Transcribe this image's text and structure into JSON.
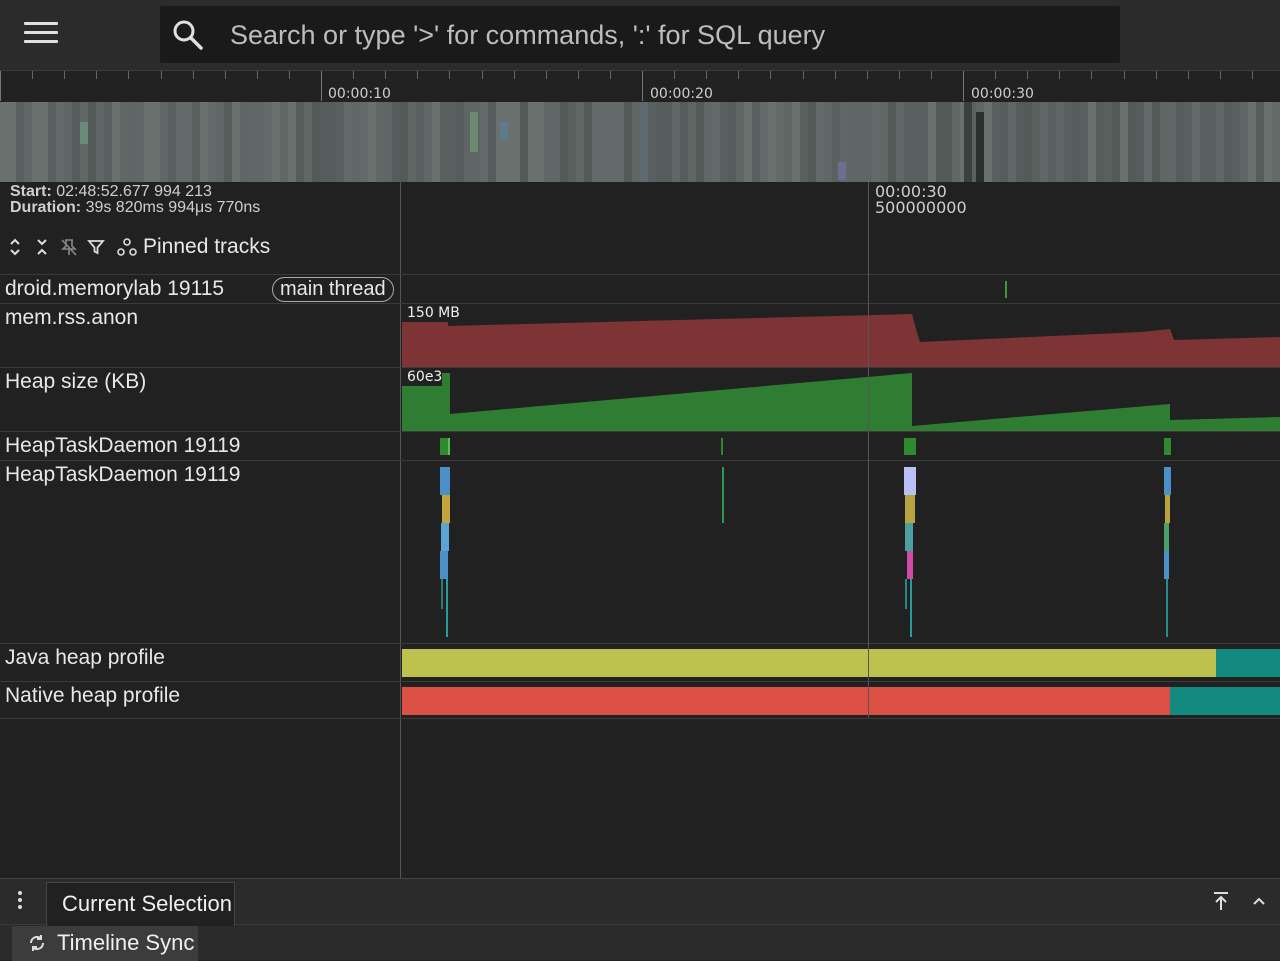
{
  "search": {
    "placeholder": "Search or type '>' for commands, ':' for SQL query"
  },
  "ruler": {
    "labels": [
      "00:00:10",
      "00:00:20",
      "00:00:30"
    ]
  },
  "info": {
    "start_label": "Start:",
    "start_value": "02:48:52.677 994 213",
    "duration_label": "Duration:",
    "duration_value": "39s 820ms 994μs 770ns"
  },
  "cursor": {
    "time": "00:00:30",
    "sub": "500000000"
  },
  "toolbar": {
    "pinned_label": "Pinned tracks"
  },
  "tracks": [
    {
      "label": "droid.memorylab 19115",
      "chip": "main thread"
    },
    {
      "label": "mem.rss.anon",
      "scale": "150 MB"
    },
    {
      "label": "Heap size (KB)",
      "scale": "60e3"
    },
    {
      "label": "HeapTaskDaemon 19119"
    },
    {
      "label": "HeapTaskDaemon 19119"
    },
    {
      "label": "Java heap profile"
    },
    {
      "label": "Native heap profile"
    }
  ],
  "bottom": {
    "tab_label": "Current Selection",
    "sync_label": "Timeline Sync"
  },
  "colors": {
    "rss": "#7e3434",
    "heap": "#2f7d32",
    "java_profile": "#bcc24d",
    "native_profile": "#dc4f45",
    "profile_tail": "#128a80"
  }
}
